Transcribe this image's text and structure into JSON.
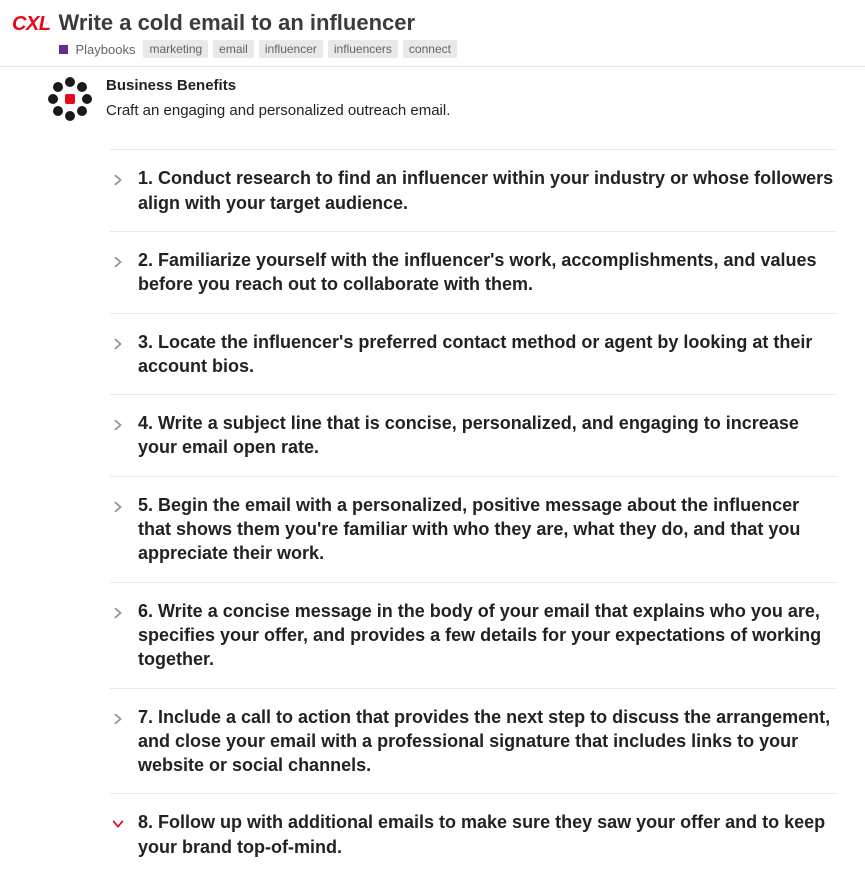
{
  "header": {
    "logo": "CXL",
    "title": "Write a cold email to an influencer",
    "category": "Playbooks",
    "tags": [
      "marketing",
      "email",
      "influencer",
      "influencers",
      "connect"
    ]
  },
  "benefits": {
    "heading": "Business Benefits",
    "description": "Craft an engaging and personalized outreach email."
  },
  "steps": [
    {
      "text": "1. Conduct research to find an influencer within your industry or whose followers align with your target audience.",
      "expanded": false
    },
    {
      "text": "2. Familiarize yourself with the influencer's work, accomplishments, and values before you reach out to collaborate with them.",
      "expanded": false
    },
    {
      "text": "3. Locate the influencer's preferred contact method or agent by looking at their account bios.",
      "expanded": false
    },
    {
      "text": "4. Write a subject line that is concise, personalized, and engaging to increase your email open rate.",
      "expanded": false
    },
    {
      "text": "5. Begin the email with a personalized, positive message about the influencer that shows them you're familiar with who they are, what they do, and that you appreciate their work.",
      "expanded": false
    },
    {
      "text": "6. Write a concise message in the body of your email that explains who you are, specifies your offer, and provides a few details for your expectations of working together.",
      "expanded": false
    },
    {
      "text": "7. Include a call to action that provides the next step to discuss the arrangement, and close your email with a professional signature that includes links to your website or social channels.",
      "expanded": false
    },
    {
      "text": "8. Follow up with additional emails to make sure they saw your offer and to keep your brand top-of-mind.",
      "expanded": true
    }
  ]
}
